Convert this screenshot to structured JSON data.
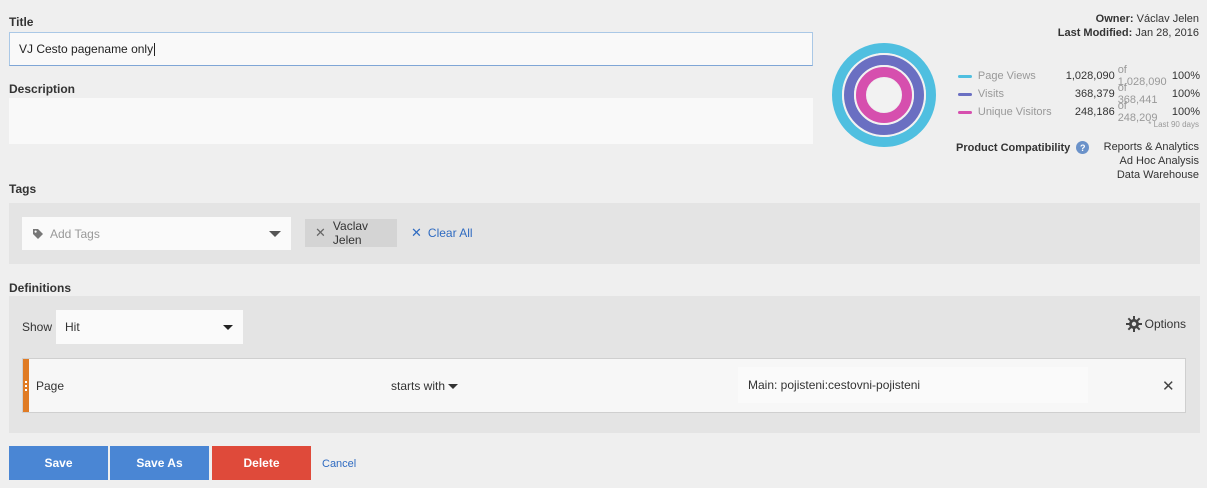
{
  "title_field": {
    "label": "Title",
    "value": "VJ Cesto pagename only"
  },
  "description_field": {
    "label": "Description",
    "value": ""
  },
  "meta": {
    "owner_label": "Owner:",
    "owner_value": "Václav Jelen",
    "modified_label": "Last Modified:",
    "modified_value": "Jan 28, 2016"
  },
  "summary": {
    "rows": [
      {
        "name": "Page Views",
        "value": "1,028,090",
        "of": "of 1,028,090",
        "pct": "100%",
        "color": "#4fbfe0"
      },
      {
        "name": "Visits",
        "value": "368,379",
        "of": "of 368,441",
        "pct": "100%",
        "color": "#6a6fc2"
      },
      {
        "name": "Unique Visitors",
        "value": "248,186",
        "of": "of 248,209",
        "pct": "100%",
        "color": "#d64fae"
      }
    ],
    "footnote": "* Last 90 days"
  },
  "compatibility": {
    "label": "Product Compatibility",
    "help_icon": "?",
    "products": [
      "Reports & Analytics",
      "Ad Hoc Analysis",
      "Data Warehouse"
    ]
  },
  "tags": {
    "label": "Tags",
    "placeholder": "Add Tags",
    "chips": [
      "Vaclav Jelen"
    ],
    "clear_all": "Clear All"
  },
  "definitions": {
    "label": "Definitions",
    "show_label": "Show",
    "show_value": "Hit",
    "options_label": "Options",
    "rule": {
      "field": "Page",
      "operator": "starts with",
      "value": "Main: pojisteni:cestovni-pojisteni"
    }
  },
  "actions": {
    "save": "Save",
    "save_as": "Save As",
    "delete": "Delete",
    "cancel": "Cancel"
  }
}
